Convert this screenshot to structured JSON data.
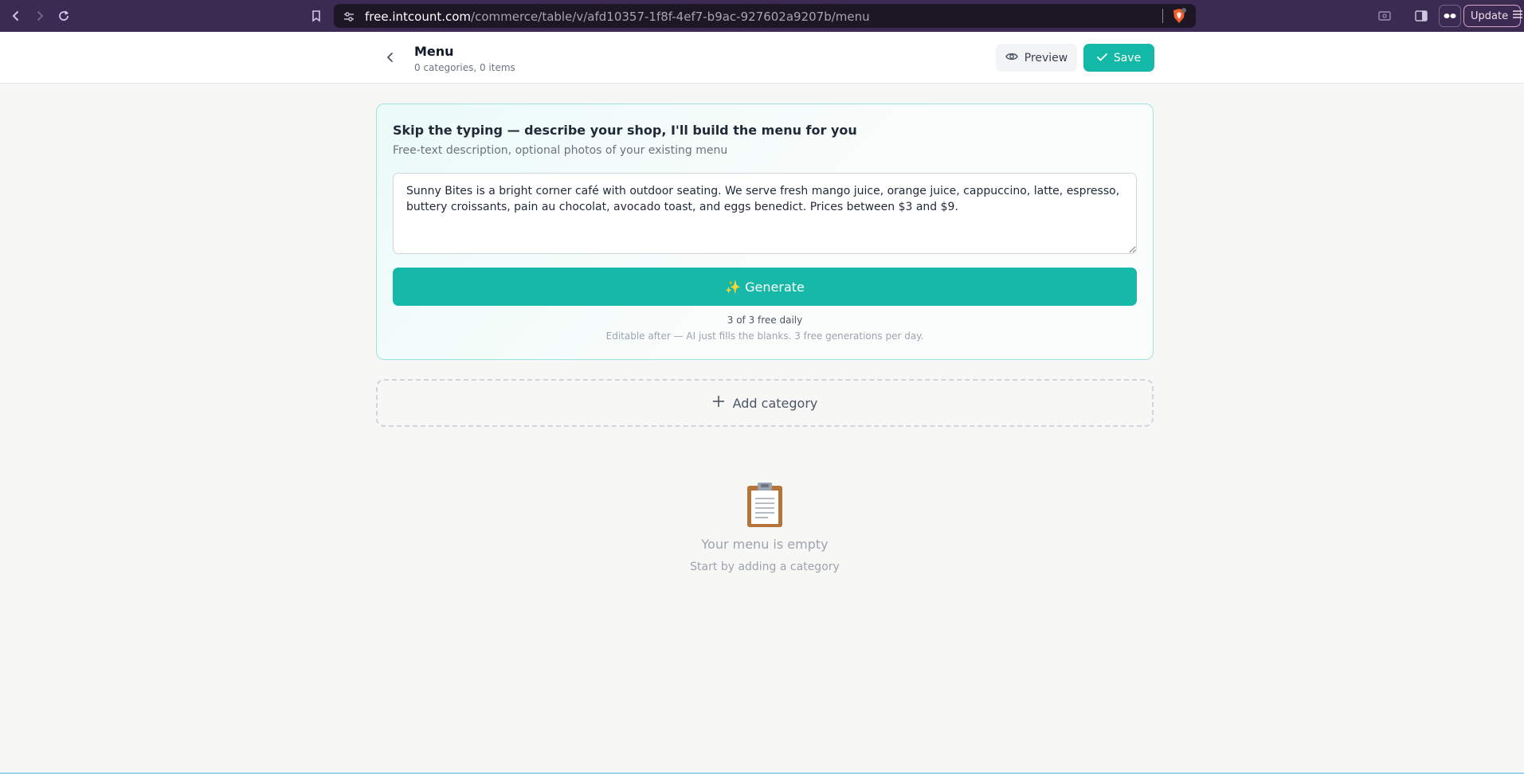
{
  "browser": {
    "url_domain": "free.intcount.com",
    "url_path": "/commerce/table/v/afd10357-1f8f-4ef7-b9ac-927602a9207b/menu",
    "update_label": "Update",
    "accent": "#3b2a52"
  },
  "header": {
    "title": "Menu",
    "subtitle": "0 categories, 0 items",
    "preview_label": "Preview",
    "save_label": "Save"
  },
  "ai_card": {
    "title": "Skip the typing — describe your shop, I'll build the menu for you",
    "subtitle": "Free-text description, optional photos of your existing menu",
    "description": "Sunny Bites is a bright corner café with outdoor seating. We serve fresh mango juice, orange juice, cappuccino, latte, espresso, buttery croissants, pain au chocolat, avocado toast, and eggs benedict. Prices between $3 and $9.",
    "generate_label": "✨ Generate",
    "quota": "3 of 3 free daily",
    "hint": "Editable after — AI just fills the blanks. 3 free generations per day."
  },
  "add_category_label": "Add category",
  "empty_state": {
    "icon": "clipboard-icon",
    "title": "Your menu is empty",
    "subtitle": "Start by adding a category"
  },
  "colors": {
    "primary": "#14b8a6",
    "card_border": "#9fe3dc"
  }
}
